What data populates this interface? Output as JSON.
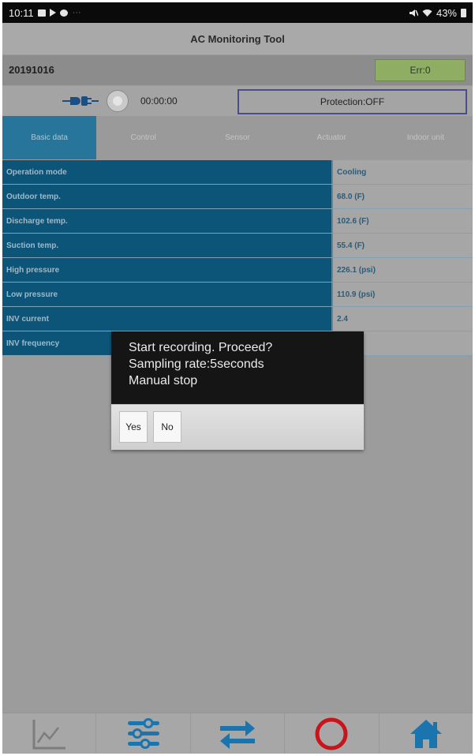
{
  "status_bar": {
    "time": "10:11",
    "battery": "43%",
    "dots": "···"
  },
  "app": {
    "title": "AC Monitoring Tool"
  },
  "info": {
    "date": "20191016",
    "error": "Err:0"
  },
  "recording": {
    "elapsed": "00:00:00",
    "protection": "Protection:OFF"
  },
  "tabs": [
    {
      "label": "Basic data"
    },
    {
      "label": "Control"
    },
    {
      "label": "Sensor"
    },
    {
      "label": "Actuator"
    },
    {
      "label": "Indoor unit"
    }
  ],
  "table": {
    "rows": [
      {
        "label": "Operation mode",
        "value": "Cooling"
      },
      {
        "label": "Outdoor temp.",
        "value": "68.0 (F)"
      },
      {
        "label": "Discharge temp.",
        "value": "102.6 (F)"
      },
      {
        "label": "Suction temp.",
        "value": "55.4 (F)"
      },
      {
        "label": "High pressure",
        "value": "226.1 (psi)"
      },
      {
        "label": "Low pressure",
        "value": "110.9 (psi)"
      },
      {
        "label": "INV current",
        "value": "2.4"
      },
      {
        "label": "INV frequency",
        "value": ""
      }
    ]
  },
  "dialog": {
    "lines": [
      "Start recording. Proceed?",
      "Sampling rate:5seconds",
      "Manual stop"
    ],
    "yes_label": "Yes",
    "no_label": "No"
  },
  "navbar": {
    "icons": [
      "chart-icon",
      "settings-sliders-icon",
      "swap-arrows-icon",
      "record-circle-icon",
      "home-icon"
    ]
  },
  "colors": {
    "accent": "#27759a",
    "label_bg": "#0c5579",
    "error_badge": "#8fae63",
    "record_red": "#c8141b",
    "nav_blue": "#1a74ad"
  }
}
